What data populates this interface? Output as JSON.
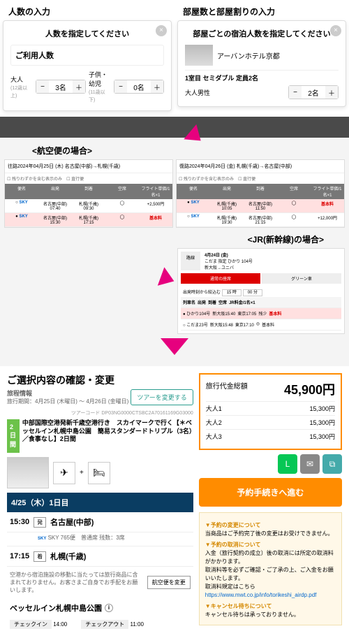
{
  "top": {
    "left_label": "人数の入力",
    "right_label": "部屋数と部屋割りの入力",
    "panel1": {
      "title": "人数を指定してください",
      "field": "ご利用人数",
      "adult_label": "大人",
      "adult_sub": "(12歳以上)",
      "adult_val": "3名",
      "child_label": "子供・幼児",
      "child_sub": "(11歳以下)",
      "child_val": "0名"
    },
    "panel2": {
      "title": "部屋ごとの宿泊人数を指定してください",
      "hotel": "アーバンホテル京都",
      "room_line": "1室目 セミダブル 定員2名",
      "male_label": "大人男性",
      "male_val": "2名"
    }
  },
  "mid": {
    "flight_title": "<航空便の場合>",
    "jr_title": "<JR(新幹線)の場合>",
    "fp1_head": "往路2024年04月25日 (木) 名古屋(中部)→札幌(千歳)",
    "fp2_head": "復路2024年04月26日 (金) 札幌(千歳)→名古屋(中部)",
    "opt1": "残りわずかを含む表示のみ",
    "opt2": "直行便",
    "th": [
      "便名",
      "出発",
      "到着",
      "空席",
      "フライト単価/1名×1"
    ],
    "sky": "SKY",
    "fp1_rows": [
      {
        "dep": "名古屋(中部)",
        "dt": "07:40",
        "arr": "札幌(千歳)",
        "at": "09:30",
        "seat": "◯",
        "price": "+2,500円"
      },
      {
        "dep": "名古屋(中部)",
        "dt": "15:30",
        "arr": "札幌(千歳)",
        "at": "17:15",
        "seat": "◯",
        "price": "基本料",
        "sel": true
      }
    ],
    "fp2_rows": [
      {
        "dep": "札幌(千歳)",
        "dt": "10:05",
        "arr": "名古屋(中部)",
        "at": "11:50",
        "seat": "◯",
        "price": "基本料",
        "sel": true
      },
      {
        "dep": "札幌(千歳)",
        "dt": "19:30",
        "arr": "名古屋(中部)",
        "at": "21:15",
        "seat": "◯",
        "price": "+12,000円"
      }
    ],
    "jr": {
      "route_label": "路線",
      "date": "4月24日 (金)",
      "train1": "こだま 指定",
      "train2": "ひかり 104号",
      "train3": "新大阪→ユニバ",
      "tabs": [
        "通常の座席",
        "グリーン車"
      ],
      "filter": "出発時刻から絞込む",
      "f1": "15 時",
      "f2": "00 分",
      "cols": [
        "列車名",
        "出発",
        "到着",
        "空席",
        "JR料金/1名×1"
      ],
      "r1": {
        "n": "ひかり104号",
        "d": "新大阪15:40",
        "a": "東京17:05",
        "s": "残少",
        "p": "基本料"
      },
      "r2": {
        "n": "こだま23号",
        "d": "新大阪15:48",
        "a": "東京17:10",
        "s": "◎",
        "p": "基本料"
      }
    }
  },
  "bottom": {
    "left": {
      "h2": "ご選択内容の確認・変更",
      "sub": "旅程情報",
      "period": "旅行期間：4月25日 (木曜日) ～ 4月26日 (金曜日)",
      "tour_btn": "ツアーを変更する",
      "tour_code": "ツアーコード DP03NG0000CTSBC2A70161169G03000",
      "badge": "2日間",
      "tour_title": "中部国際空港発新千歳空港行き　スカイマークで行く【＊ベッセルイン札幌中島公園　簡易スタンダードトリプル（3名）／食事なし】2日間",
      "day_header": "4/25（木）1日目",
      "seg1": {
        "time": "15:30",
        "tag": "発",
        "city": "名古屋(中部)"
      },
      "flight_det": "SKY 765便　普通席 残数：3席",
      "seg2": {
        "time": "17:15",
        "tag": "着",
        "city": "札幌(千歳)"
      },
      "note": "空港から宿泊施設の移動に当たっては旅行商品に含まれておりません。お客さまご自身でお手配をお願いします。",
      "chg_btn": "航空便を変更",
      "hotel": "ベッセルイン札幌中島公園",
      "ci_l": "チェックイン",
      "ci_v": "14:00",
      "co_l": "チェックアウト",
      "co_v": "11:00"
    },
    "right": {
      "pb_label": "旅行代金総額",
      "total": "45,900円",
      "rows": [
        {
          "l": "大人1",
          "v": "15,300円"
        },
        {
          "l": "大人2",
          "v": "15,300円"
        },
        {
          "l": "大人3",
          "v": "15,300円"
        }
      ],
      "proceed": "予約手続きへ進む",
      "info": {
        "h1": "▼予約の変更について",
        "t1": "当商品はご予約完了後の変更はお受けできません。",
        "h2": "▼予約の取消について",
        "t2a": "入金（旅行契約の成立）後の取消には所定の取消料がかかります。",
        "t2b": "取消料等を必ずご確認・ご了承の上、ご入金をお願いいたします。",
        "t2c": "取消料規定はこちら",
        "link": "https://www.mwt.co.jp/info/torikeshi_airdp.pdf",
        "h3": "▼キャンセル待ちについて",
        "t3": "キャンセル待ちは承っておりません。"
      }
    }
  }
}
